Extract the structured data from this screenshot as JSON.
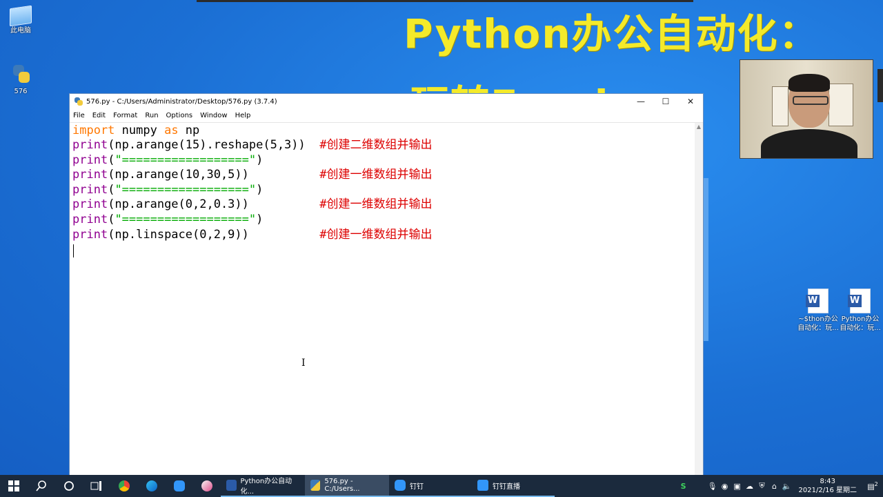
{
  "desktop": {
    "banner_line1": "Python办公自动化：",
    "banner_line2": "玩转Excel",
    "icons": [
      {
        "label": "此电脑"
      },
      {
        "label": "576"
      },
      {
        "label": "~$thon办公自动化：玩..."
      },
      {
        "label": "Python办公自动化：玩..."
      }
    ]
  },
  "window": {
    "title": "576.py - C:/Users/Administrator/Desktop/576.py (3.7.4)",
    "minimize": "—",
    "maximize": "☐",
    "close": "✕",
    "menu": [
      "File",
      "Edit",
      "Format",
      "Run",
      "Options",
      "Window",
      "Help"
    ]
  },
  "code": {
    "l1_kw1": "import",
    "l1_mod": " numpy ",
    "l1_kw2": "as",
    "l1_alias": " np",
    "l2_fn": "print",
    "l2_args": "(np.arange(15).reshape(5,3))  ",
    "l2_cmt": "#创建二维数组并输出",
    "sep_fn": "print",
    "sep_open": "(",
    "sep_str": "\"==================\"",
    "sep_close": ")",
    "l4_args": "(np.arange(10,30,5))          ",
    "l4_cmt": "#创建一维数组并输出",
    "l6_args": "(np.arange(0,2,0.3))          ",
    "l6_cmt": "#创建一维数组并输出",
    "l8_args": "(np.linspace(0,2,9))          ",
    "l8_cmt": "#创建一维数组并输出"
  },
  "taskbar": {
    "apps": [
      {
        "label": "Python办公自动化..."
      },
      {
        "label": "576.py - C:/Users..."
      },
      {
        "label": "钉钉"
      },
      {
        "label": "钉钉直播"
      }
    ],
    "time": "8:43",
    "date": "2021/2/16 星期二",
    "notification_count": "2"
  },
  "colors": {
    "keyword": "#ff7700",
    "builtin": "#900090",
    "string": "#00aa00",
    "comment": "#dd0000",
    "banner": "#f4ea2a"
  }
}
